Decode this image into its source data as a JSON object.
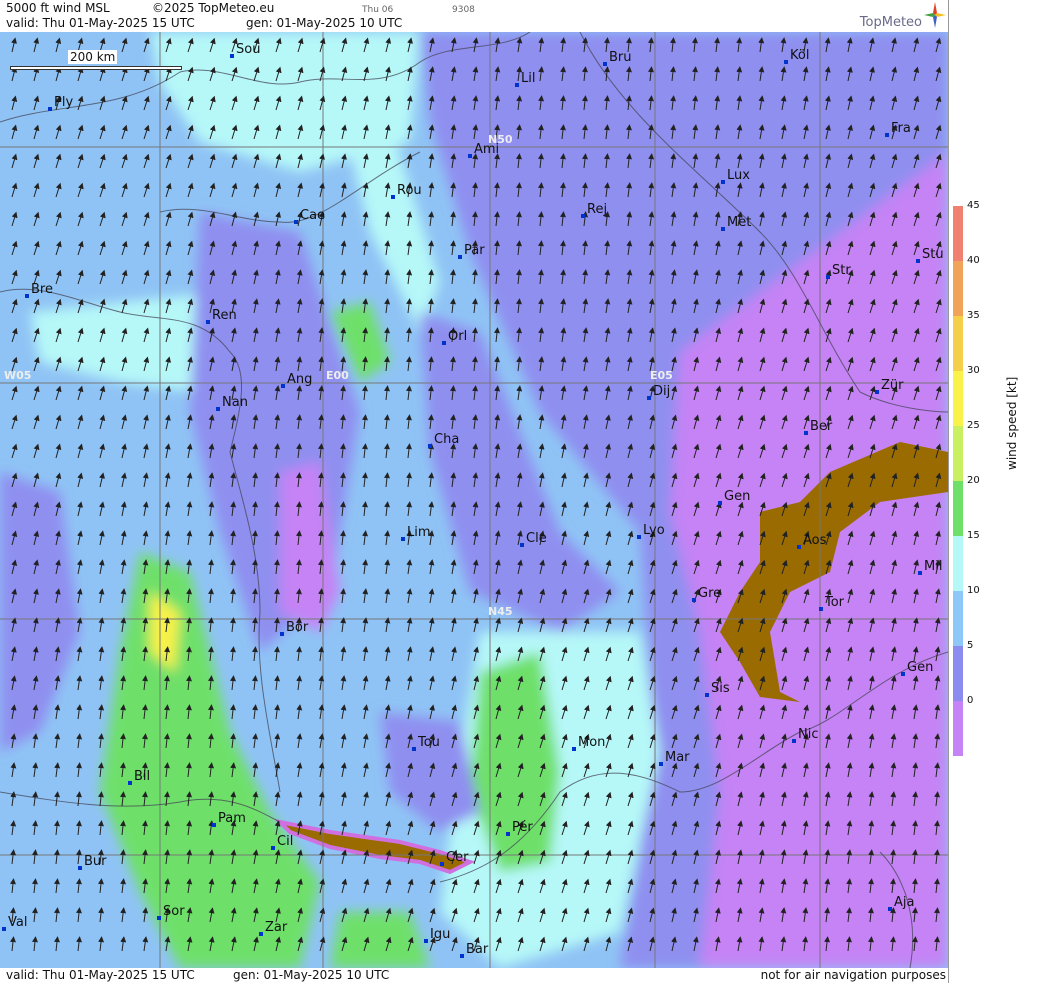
{
  "header": {
    "title": "5000 ft wind MSL",
    "copyright": "©2025 TopMeteo.eu",
    "small_day": "Thu 06",
    "small_code": "9308",
    "valid": "valid:  Thu  01-May-2025  15 UTC",
    "gen": "gen: 01-May-2025 10 UTC"
  },
  "brand": {
    "name": "TopMeteo",
    "logo_icon": "compass-star-icon"
  },
  "footer": {
    "valid": "valid:  Thu  01-May-2025  15 UTC",
    "gen": "gen: 01-May-2025 10 UTC",
    "notice": "not for air navigation purposes"
  },
  "scale_bar": {
    "label": "200 km"
  },
  "grid_labels": {
    "n50": "N50",
    "n45": "N45",
    "w05": "W05",
    "e00": "E00",
    "e05": "E05"
  },
  "cities": [
    {
      "name": "Sou"
    },
    {
      "name": "Bru"
    },
    {
      "name": "Köl"
    },
    {
      "name": "Lil"
    },
    {
      "name": "Ply"
    },
    {
      "name": "Ami"
    },
    {
      "name": "Fra"
    },
    {
      "name": "Lux"
    },
    {
      "name": "Rou"
    },
    {
      "name": "Rej"
    },
    {
      "name": "Cae"
    },
    {
      "name": "Met"
    },
    {
      "name": "Par"
    },
    {
      "name": "Stu"
    },
    {
      "name": "Bre"
    },
    {
      "name": "Str"
    },
    {
      "name": "Ren"
    },
    {
      "name": "Orl"
    },
    {
      "name": "Ang"
    },
    {
      "name": "Dij"
    },
    {
      "name": "Zür"
    },
    {
      "name": "Nan"
    },
    {
      "name": "Ber"
    },
    {
      "name": "Cha"
    },
    {
      "name": "Gen"
    },
    {
      "name": "Lim"
    },
    {
      "name": "Cle"
    },
    {
      "name": "Lyo"
    },
    {
      "name": "Aos"
    },
    {
      "name": "Mil"
    },
    {
      "name": "Gre"
    },
    {
      "name": "Tor"
    },
    {
      "name": "Bor"
    },
    {
      "name": "Gen"
    },
    {
      "name": "Sis"
    },
    {
      "name": "Nic"
    },
    {
      "name": "Tou"
    },
    {
      "name": "Mon"
    },
    {
      "name": "Mar"
    },
    {
      "name": "Bil"
    },
    {
      "name": "Pam"
    },
    {
      "name": "Pér"
    },
    {
      "name": "Cil"
    },
    {
      "name": "Cer"
    },
    {
      "name": "Bur"
    },
    {
      "name": "Sor"
    },
    {
      "name": "Aja"
    },
    {
      "name": "Val"
    },
    {
      "name": "Zar"
    },
    {
      "name": "Igu"
    },
    {
      "name": "Bar"
    }
  ],
  "legend": {
    "title": "wind speed [kt]",
    "ticks": [
      "45",
      "40",
      "35",
      "30",
      "25",
      "20",
      "15",
      "10",
      "5",
      "0"
    ],
    "colors": [
      "#f08070",
      "#f2a35a",
      "#f6cf4a",
      "#f8f24a",
      "#c8f060",
      "#6ee06a",
      "#b6f8f8",
      "#8ec8f8",
      "#8b8bf0",
      "#c583f5"
    ]
  }
}
